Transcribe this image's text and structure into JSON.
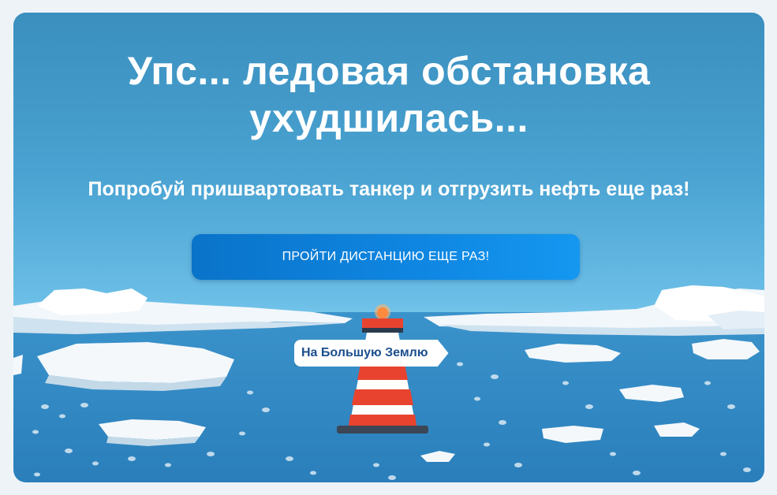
{
  "screen": {
    "title_line1": "Упс... ледовая обстановка",
    "title_line2": "ухудшилась...",
    "subtitle": "Попробуй пришвартовать танкер и отгрузить нефть еще раз!",
    "retry_button_label": "ПРОЙТИ ДИСТАНЦИЮ ЕЩЕ РАЗ!",
    "sign_label": "На Большую Землю"
  },
  "colors": {
    "sky_top": "#3a8fbe",
    "water": "#2f86c0",
    "button": "#0f87e2",
    "buoy_red": "#e8432f",
    "buoy_light": "#ff8a3d"
  },
  "icons": {
    "buoy": "lighthouse-buoy-icon"
  }
}
